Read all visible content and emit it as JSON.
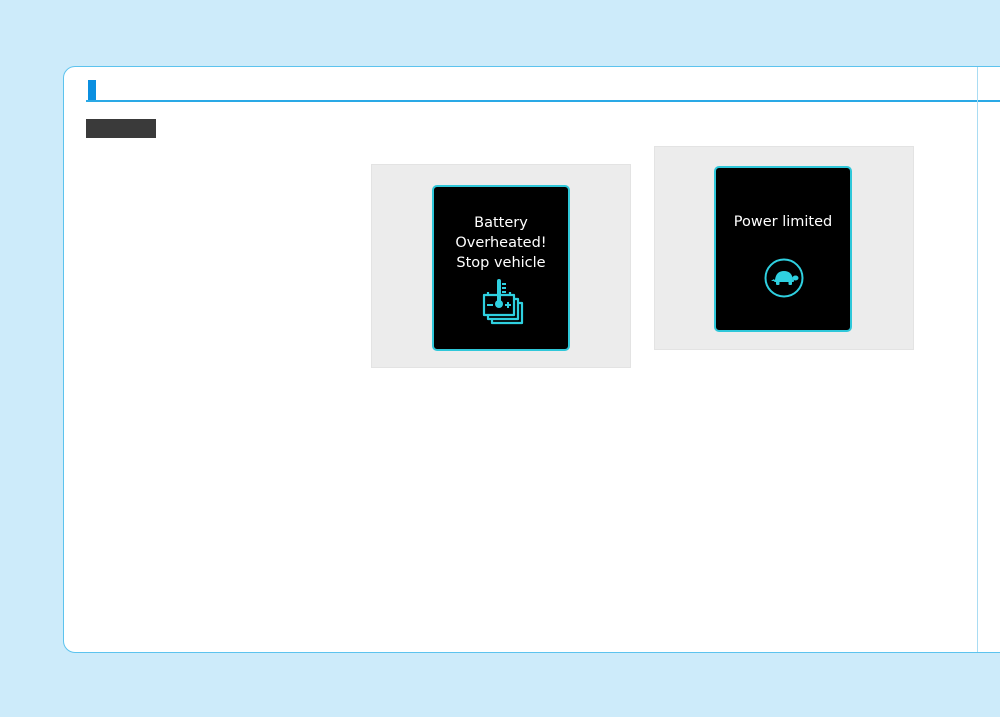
{
  "figures": [
    {
      "lines": [
        "Battery",
        "Overheated!",
        "Stop vehicle"
      ],
      "icon": "battery-temperature-icon"
    },
    {
      "lines": [
        "Power limited"
      ],
      "icon": "turtle-icon"
    }
  ],
  "colors": {
    "page_background": "#cdebfa",
    "panel_border": "#5cc3ee",
    "header_accent": "#0b8fe0",
    "screen_background": "#000000",
    "screen_border": "#2fc7d9",
    "icon_color": "#2fd0e0",
    "tag_background": "#3a3a3a"
  }
}
